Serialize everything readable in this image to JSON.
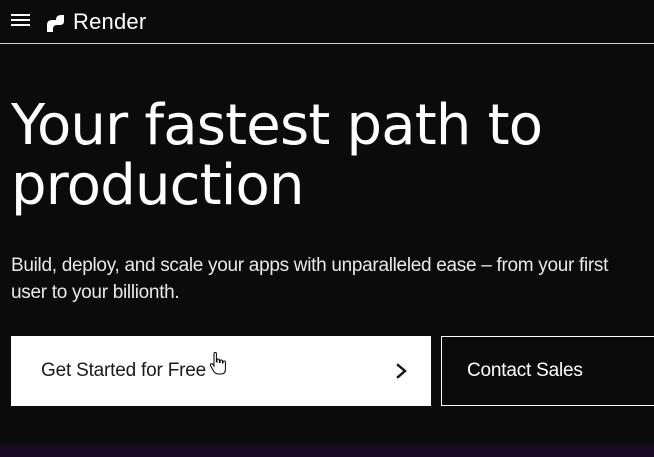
{
  "header": {
    "brand_name": "Render",
    "logo_icon": "render-logo-icon",
    "menu_icon": "hamburger-menu-icon"
  },
  "hero": {
    "title": "Your fastest path to production",
    "subtitle": "Build, deploy, and scale your apps with unparalleled ease – from your first user to your billionth."
  },
  "cta": {
    "primary_label": "Get Started for Free",
    "primary_icon": "chevron-right-icon",
    "secondary_label": "Contact Sales"
  },
  "colors": {
    "background": "#0b0b0b",
    "primary_button_bg": "#ffffff",
    "bottom_band": "#1b0a26"
  }
}
